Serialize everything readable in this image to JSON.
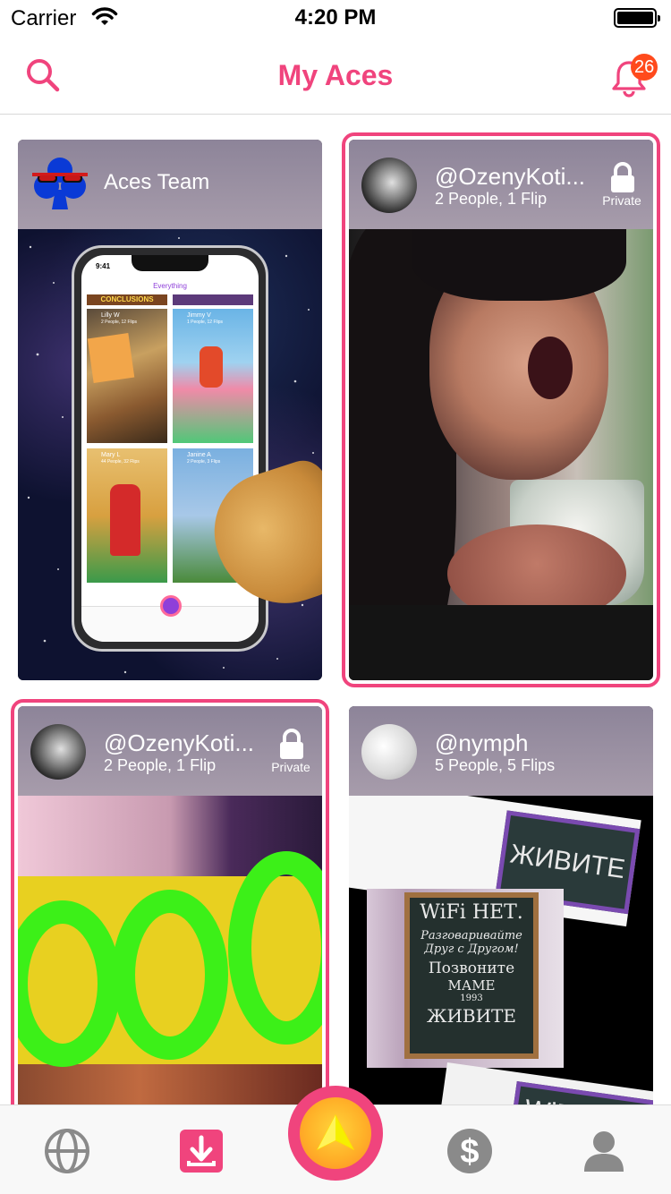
{
  "status_bar": {
    "carrier": "Carrier",
    "time": "4:20 PM"
  },
  "nav": {
    "title": "My Aces",
    "notification_count": "26"
  },
  "colors": {
    "accent": "#f0447d",
    "badge": "#ff4a1c"
  },
  "cards": [
    {
      "title": "Aces Team",
      "selected": false
    },
    {
      "handle": "@OzenyKoti...",
      "meta": "2 People, 1 Flip",
      "privacy": "Private",
      "selected": true
    },
    {
      "handle": "@OzenyKoti...",
      "meta": "2 People, 1 Flip",
      "privacy": "Private",
      "selected": true
    },
    {
      "handle": "@nymph",
      "meta": "5 People, 5 Flips",
      "selected": false
    }
  ],
  "mini_phone": {
    "time": "9:41",
    "title": "Everything",
    "banner": "CONCLUSIONS",
    "tiles": [
      {
        "name": "Lilly W",
        "meta": "2 People, 12 Flips"
      },
      {
        "name": "Jimmy V",
        "meta": "1 People, 12 Flips"
      },
      {
        "name": "Mary L",
        "meta": "44 People, 32 Flips"
      },
      {
        "name": "Janine A",
        "meta": "2 People, 3 Flips"
      }
    ]
  },
  "chalkboard": {
    "line1": "WiFi НЕТ.",
    "line2": "Разговаривайте",
    "line3": "Друг с Другом!",
    "line4": "Позвоните",
    "line5": "МАМЕ",
    "line6": "1993",
    "line7": "ЖИВИТЕ",
    "top_text": "ЖИВИТЕ",
    "bottom_text": "WiFi"
  },
  "tabs": [
    {
      "icon": "globe-icon"
    },
    {
      "icon": "inbox-download-icon"
    },
    {
      "icon": "aces-arrow-icon"
    },
    {
      "icon": "dollar-icon"
    },
    {
      "icon": "profile-icon"
    }
  ]
}
